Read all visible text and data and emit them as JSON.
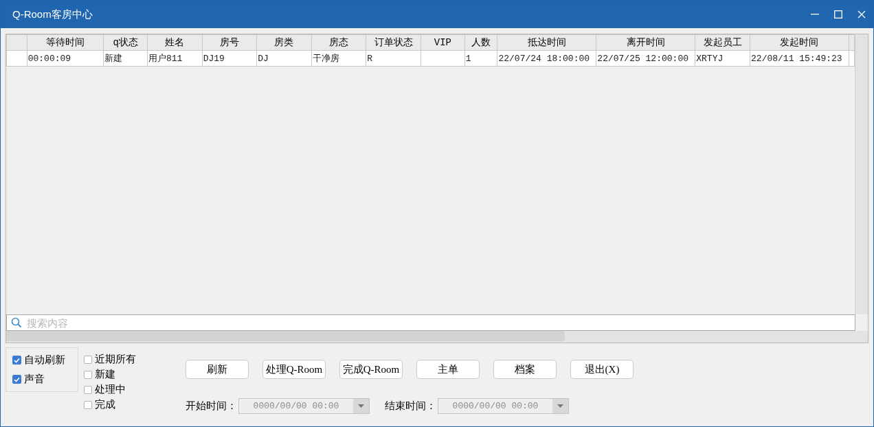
{
  "window": {
    "title": "Q-Room客房中心"
  },
  "table": {
    "columns": [
      "等待时间",
      "q状态",
      "姓名",
      "房号",
      "房类",
      "房态",
      "订单状态",
      "VIP",
      "人数",
      "抵达时间",
      "离开时间",
      "发起员工",
      "发起时间"
    ],
    "rows": [
      [
        "00:00:09",
        "新建",
        "用户811",
        "DJ19",
        "DJ",
        "干净房",
        "R",
        "",
        "1",
        "22/07/24 18:00:00",
        "22/07/25 12:00:00",
        "XRTYJ",
        "22/08/11 15:49:23"
      ]
    ]
  },
  "search": {
    "placeholder": "搜索内容"
  },
  "options": [
    {
      "label": "自动刷新",
      "checked": true
    },
    {
      "label": "声音",
      "checked": true
    }
  ],
  "filters": [
    {
      "label": "近期所有",
      "checked": false
    },
    {
      "label": "新建",
      "checked": false
    },
    {
      "label": "处理中",
      "checked": false
    },
    {
      "label": "完成",
      "checked": false
    }
  ],
  "buttons": [
    "刷新",
    "处理Q-Room",
    "完成Q-Room",
    "主单",
    "档案",
    "退出(X)"
  ],
  "start": {
    "label": "开始时间：",
    "value": "0000/00/00 00:00"
  },
  "end": {
    "label": "结束时间：",
    "value": "0000/00/00 00:00"
  }
}
